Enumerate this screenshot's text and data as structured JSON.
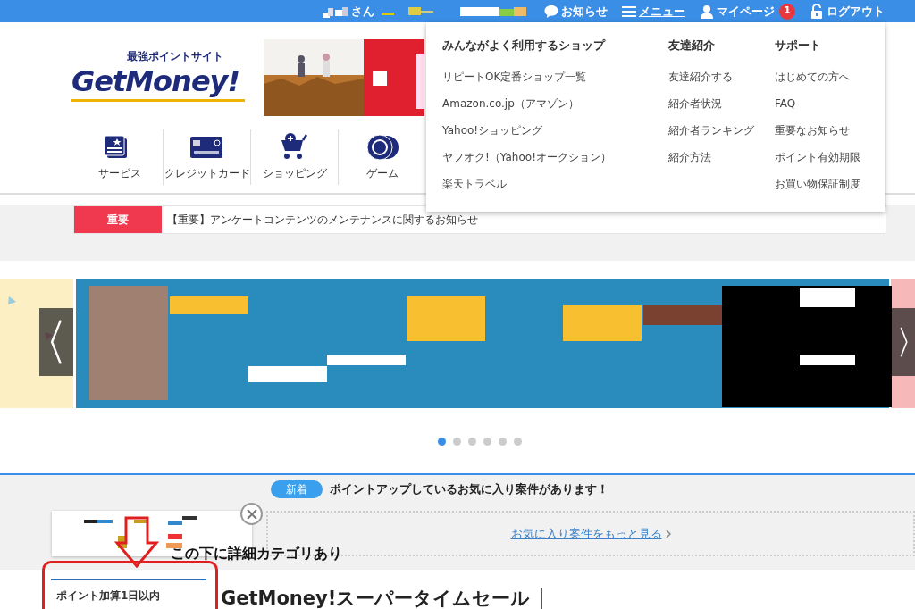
{
  "top_bar": {
    "user_suffix": "さん",
    "items": [
      {
        "kind": "notice",
        "label": "お知らせ"
      },
      {
        "kind": "menu",
        "label": "メニュー",
        "expanded": true
      },
      {
        "kind": "mypage",
        "label": "マイページ",
        "badge": "1"
      },
      {
        "kind": "logout",
        "label": "ログアウト"
      }
    ]
  },
  "header": {
    "logo_tagline": "最強ポイントサイト",
    "logo": "GetMoney!"
  },
  "categories": [
    {
      "kind": "service",
      "label": "サービス"
    },
    {
      "kind": "credit",
      "label": "クレジットカード"
    },
    {
      "kind": "shopping",
      "label": "ショッピング"
    },
    {
      "kind": "game",
      "label": "ゲーム"
    }
  ],
  "menu_dropdown": {
    "columns": [
      {
        "heading": "みんながよく利用するショップ",
        "items": [
          "リピートOK定番ショップ一覧",
          "Amazon.co.jp（アマゾン）",
          "Yahoo!ショッピング",
          "ヤフオク!（Yahoo!オークション）",
          "楽天トラベル"
        ]
      },
      {
        "heading": "友達紹介",
        "items": [
          "友達紹介する",
          "紹介者状況",
          "紹介者ランキング",
          "紹介方法"
        ]
      },
      {
        "heading": "サポート",
        "items": [
          "はじめての方へ",
          "FAQ",
          "重要なお知らせ",
          "ポイント有効期限",
          "お買い物保証制度"
        ]
      }
    ]
  },
  "notice": {
    "tag": "重要",
    "text": "【重要】アンケートコンテンツのメンテナンスに関するお知らせ"
  },
  "carousel": {
    "dots": [
      {
        "selected": true
      },
      {
        "selected": false
      },
      {
        "selected": false
      },
      {
        "selected": false
      },
      {
        "selected": false
      },
      {
        "selected": false
      }
    ]
  },
  "favorites": {
    "badge": "新着",
    "message": "ポイントアップしているお気に入り案件があります！",
    "link": "お気に入り案件をもっと見る"
  },
  "annotation": {
    "text": "この下に詳細カテゴリあり"
  },
  "section": {
    "sidebar_heading": "ポイント加算1日以内",
    "title": "GetMoney!スーパータイムセール"
  }
}
